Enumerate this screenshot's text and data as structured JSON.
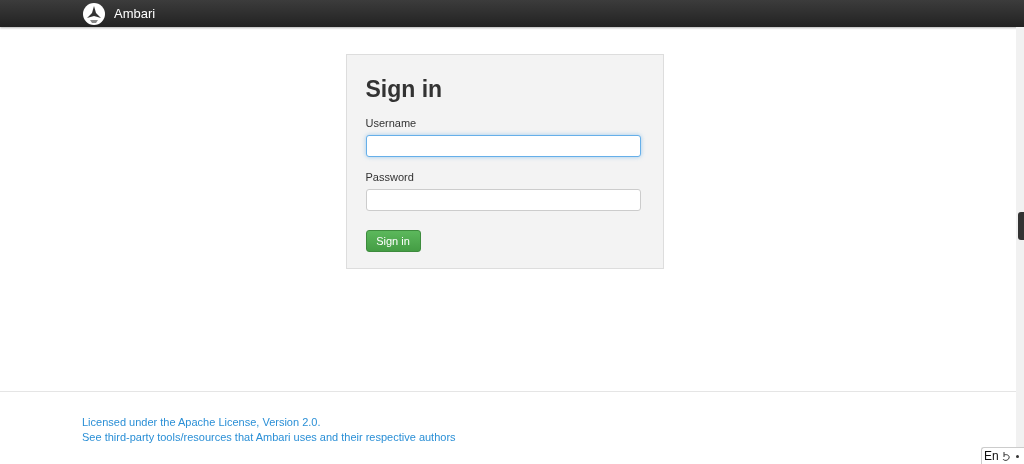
{
  "navbar": {
    "brand": "Ambari"
  },
  "login": {
    "title": "Sign in",
    "fields": [
      {
        "label": "Username",
        "focused": true
      },
      {
        "label": "Password",
        "focused": false
      }
    ],
    "button": "Sign in"
  },
  "footer": {
    "links": [
      "Licensed under the Apache License, Version 2.0.",
      "See third-party tools/resources that Ambari uses and their respective authors"
    ]
  },
  "input_indicator": {
    "label": "En"
  }
}
